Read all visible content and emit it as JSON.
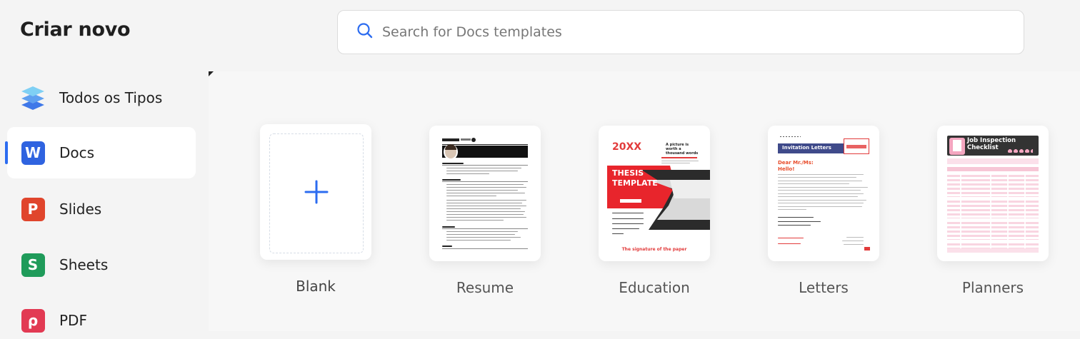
{
  "sidebar": {
    "title": "Criar novo",
    "items": [
      {
        "label": "Todos os Tipos",
        "icon": "layers-icon"
      },
      {
        "label": "Docs",
        "icon": "docs-icon",
        "letter": "W",
        "color": "#2f63e0",
        "active": true
      },
      {
        "label": "Slides",
        "icon": "slides-icon",
        "letter": "P",
        "color": "#e0452c"
      },
      {
        "label": "Sheets",
        "icon": "sheets-icon",
        "letter": "S",
        "color": "#1f9b5a"
      },
      {
        "label": "PDF",
        "icon": "pdf-icon",
        "letter": "ρ",
        "color": "#e23a53"
      }
    ]
  },
  "search": {
    "placeholder": "Search for Docs templates",
    "icon": "search-icon"
  },
  "templates": [
    {
      "label": "Blank"
    },
    {
      "label": "Resume"
    },
    {
      "label": "Education",
      "thumb": {
        "year": "20XX",
        "title_line1": "THESIS",
        "title_line2": "TEMPLATE",
        "heading": "A picture is worth a thousand words",
        "footer": "The signature of the paper"
      }
    },
    {
      "label": "Letters",
      "thumb": {
        "banner": "Invitation Letters",
        "greeting1": "Dear Mr./Ms:",
        "greeting2": "Hello!"
      }
    },
    {
      "label": "Planners",
      "thumb": {
        "title_line1": "Job Inspection",
        "title_line2": "Checklist"
      }
    }
  ],
  "colors": {
    "accent": "#2c6cf0",
    "red": "#e23b3b",
    "pink": "#f4a6c0"
  }
}
